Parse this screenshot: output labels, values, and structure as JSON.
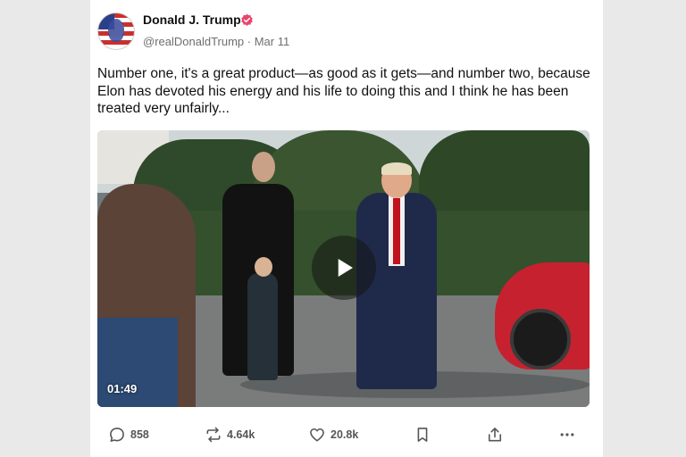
{
  "post": {
    "author_name": "Donald J. Trump",
    "handle": "@realDonaldTrump",
    "separator": " · ",
    "date": "Mar 11",
    "text": "Number one, it's a great product—as good as it gets—and number two, because Elon has devoted his energy and his life to doing this and I think he has been treated very unfairly...",
    "video_duration": "01:49"
  },
  "actions": {
    "replies": "858",
    "reposts": "4.64k",
    "likes": "20.8k"
  },
  "icons": {
    "verified": "verified-badge-icon",
    "play": "play-icon",
    "reply": "comment-icon",
    "repost": "repost-icon",
    "like": "heart-icon",
    "bookmark": "bookmark-icon",
    "share": "share-icon",
    "more": "more-icon"
  },
  "colors": {
    "verified_badge": "#e8466d",
    "page_background": "#e9e9ea",
    "card_background": "#ffffff",
    "secondary_text": "#6e6e6e"
  }
}
